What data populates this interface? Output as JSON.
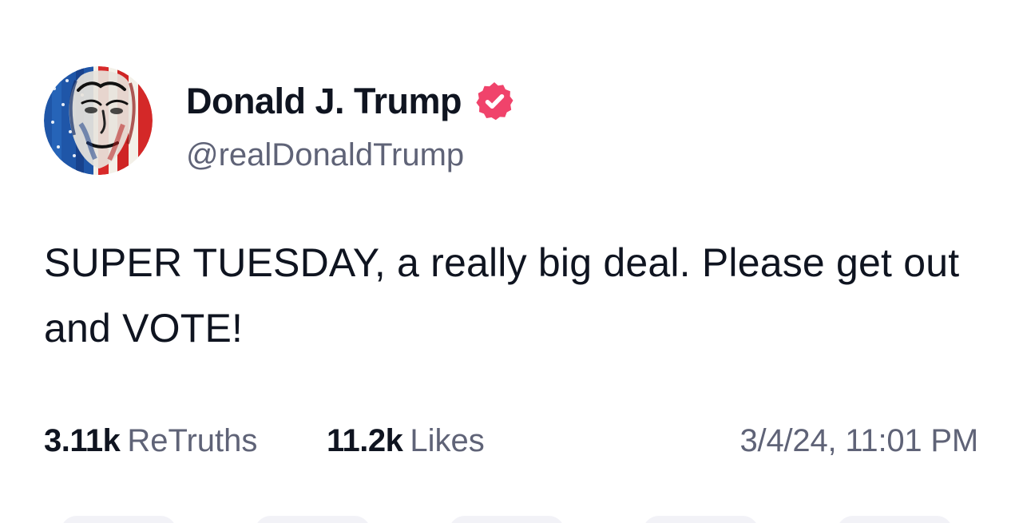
{
  "post": {
    "author": {
      "display_name": "Donald J. Trump",
      "handle": "@realDonaldTrump",
      "verified": true,
      "verified_color": "#f0436b"
    },
    "text": "SUPER TUESDAY, a really big deal. Please get out and VOTE!",
    "stats": {
      "retruths_count": "3.11k",
      "retruths_label": "ReTruths",
      "likes_count": "11.2k",
      "likes_label": "Likes"
    },
    "timestamp": "3/4/24, 11:01 PM"
  },
  "icons": {
    "avatar": "profile-photo-american-flag-portrait",
    "verified": "verified-badge-icon"
  },
  "colors": {
    "text_primary": "#0f1420",
    "text_secondary": "#5f6377",
    "background": "#ffffff",
    "verified_badge": "#f0436b"
  }
}
